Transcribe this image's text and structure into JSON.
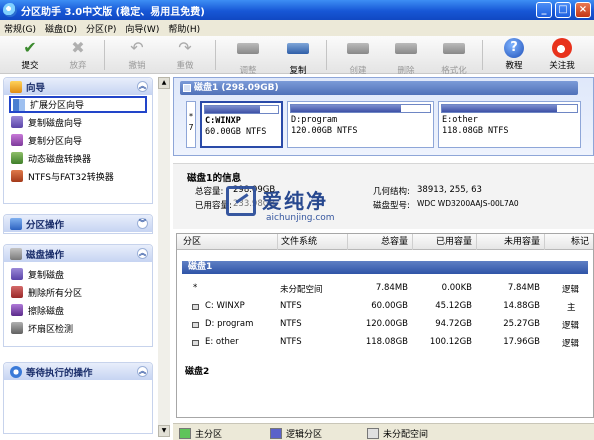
{
  "window": {
    "title": "分区助手 3.0中文版 (稳定、易用且免费)"
  },
  "menu": [
    "常规(G)",
    "磁盘(D)",
    "分区(P)",
    "向导(W)",
    "帮助(H)"
  ],
  "toolbar": {
    "commit": "提交",
    "discard": "放弃",
    "undo": "撤销",
    "redo": "重做",
    "adjust": "调整",
    "copy": "复制",
    "create": "创建",
    "delete": "删除",
    "format": "格式化",
    "tutorial": "教程",
    "follow": "关注我"
  },
  "side": {
    "wizard": {
      "title": "向导",
      "items": [
        "扩展分区向导",
        "复制磁盘向导",
        "复制分区向导",
        "动态磁盘转换器",
        "NTFS与FAT32转换器"
      ]
    },
    "partition_ops": {
      "title": "分区操作"
    },
    "disk_ops": {
      "title": "磁盘操作",
      "items": [
        "复制磁盘",
        "删除所有分区",
        "擦除磁盘",
        "坏扇区检测"
      ]
    },
    "pending": {
      "title": "等待执行的操作"
    }
  },
  "diskmap": {
    "header": "磁盘1 (298.09GB)",
    "unalloc": {
      "star": "*",
      "num": "7"
    },
    "parts": [
      {
        "name": "C:WINXP",
        "info": "60.00GB NTFS",
        "used": 0.75
      },
      {
        "name": "D:program",
        "info": "120.00GB NTFS",
        "used": 0.79
      },
      {
        "name": "E:other",
        "info": "118.08GB NTFS",
        "used": 0.85
      }
    ]
  },
  "info": {
    "title": "磁盘1的信息",
    "total_label": "总容量:",
    "total": "298.09GB",
    "used_label": "已用容量:",
    "used": "233.98GB",
    "geom_label": "几何结构:",
    "geom": "38913, 255, 63",
    "model_label": "磁盘型号:",
    "model": "WDC WD3200AAJS-00L7A0"
  },
  "watermark": {
    "cn": "爱纯净",
    "en": "aichunjing.com"
  },
  "table": {
    "headers": [
      "分区",
      "文件系统",
      "总容量",
      "已用容量",
      "未用容量",
      "标记"
    ],
    "disk1": "磁盘1",
    "rows": [
      {
        "name": "*",
        "fs": "未分配空间",
        "total": "7.84MB",
        "used": "0.00KB",
        "free": "7.84MB",
        "flag": "逻辑"
      },
      {
        "name": "C: WINXP",
        "fs": "NTFS",
        "total": "60.00GB",
        "used": "45.12GB",
        "free": "14.88GB",
        "flag": "主"
      },
      {
        "name": "D: program",
        "fs": "NTFS",
        "total": "120.00GB",
        "used": "94.72GB",
        "free": "25.27GB",
        "flag": "逻辑"
      },
      {
        "name": "E: other",
        "fs": "NTFS",
        "total": "118.08GB",
        "used": "100.12GB",
        "free": "17.96GB",
        "flag": "逻辑"
      }
    ],
    "disk2": "磁盘2"
  },
  "legend": {
    "primary": "主分区",
    "logical": "逻辑分区",
    "unallocated": "未分配空间"
  },
  "colors": {
    "primary": "#5fc45a",
    "logical": "#5b62c9",
    "unallocated": "#e0e0e0",
    "title": "#1757d6"
  }
}
